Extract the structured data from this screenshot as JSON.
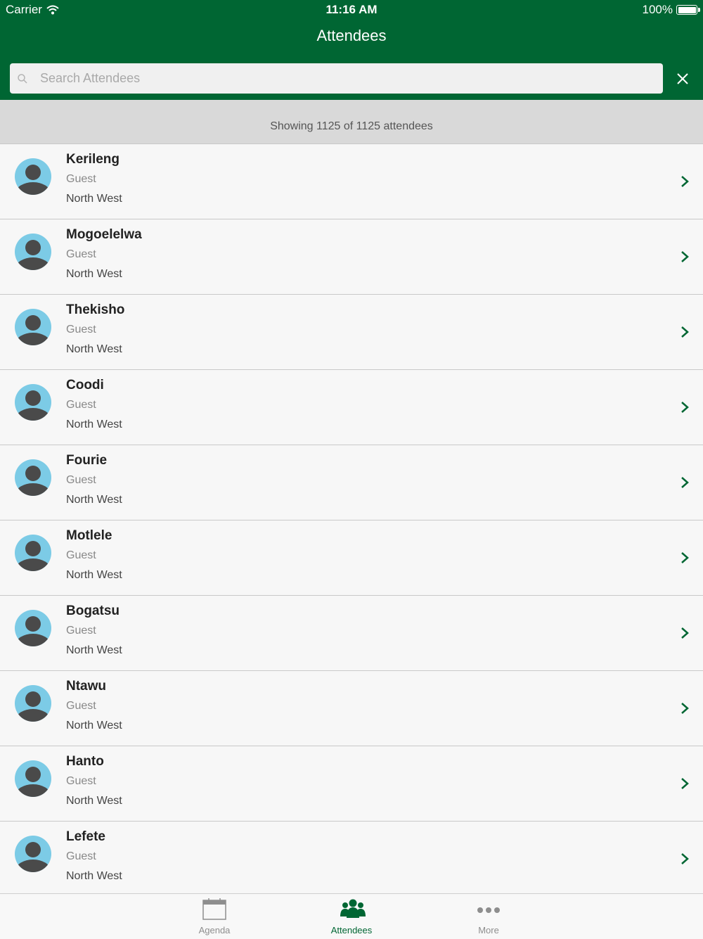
{
  "status_bar": {
    "carrier": "Carrier",
    "time": "11:16 AM",
    "battery": "100%"
  },
  "nav": {
    "title": "Attendees"
  },
  "search": {
    "placeholder": "Search Attendees",
    "value": ""
  },
  "summary": {
    "text": "Showing 1125 of 1125 attendees"
  },
  "attendees": [
    {
      "name": "Kerileng",
      "role": "Guest",
      "region": "North West"
    },
    {
      "name": "Mogoelelwa",
      "role": "Guest",
      "region": "North West"
    },
    {
      "name": "Thekisho",
      "role": "Guest",
      "region": "North West"
    },
    {
      "name": "Coodi",
      "role": "Guest",
      "region": "North West"
    },
    {
      "name": "Fourie",
      "role": "Guest",
      "region": "North West"
    },
    {
      "name": "Motlele",
      "role": "Guest",
      "region": "North West"
    },
    {
      "name": "Bogatsu",
      "role": "Guest",
      "region": "North West"
    },
    {
      "name": "Ntawu",
      "role": "Guest",
      "region": "North West"
    },
    {
      "name": "Hanto",
      "role": "Guest",
      "region": "North West"
    },
    {
      "name": "Lefete",
      "role": "Guest",
      "region": "North West"
    }
  ],
  "tabs": [
    {
      "label": "Agenda",
      "icon": "calendar-icon",
      "active": false
    },
    {
      "label": "Attendees",
      "icon": "people-icon",
      "active": true
    },
    {
      "label": "More",
      "icon": "more-icon",
      "active": false
    }
  ],
  "colors": {
    "brand": "#006633",
    "avatar_bg": "#7ccbe6",
    "avatar_fg": "#4a4a4a"
  }
}
